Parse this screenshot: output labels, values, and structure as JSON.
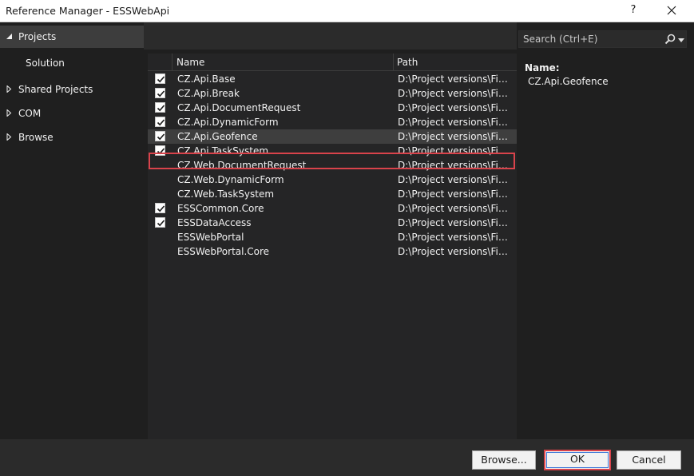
{
  "window": {
    "title": "Reference Manager - ESSWebApi",
    "help_label": "?"
  },
  "nav": {
    "items": [
      {
        "label": "Projects",
        "expanded": true,
        "selected": true
      },
      {
        "label": "Solution",
        "sub": true
      },
      {
        "label": "Shared Projects",
        "expanded": false
      },
      {
        "label": "COM",
        "expanded": false
      },
      {
        "label": "Browse",
        "expanded": false
      }
    ]
  },
  "search": {
    "placeholder": "Search (Ctrl+E)"
  },
  "list": {
    "columns": {
      "name": "Name",
      "path": "Path"
    },
    "rows": [
      {
        "name": "CZ.Api.Base",
        "path": "D:\\Project versions\\Field",
        "checked": true
      },
      {
        "name": "CZ.Api.Break",
        "path": "D:\\Project versions\\Field",
        "checked": true
      },
      {
        "name": "CZ.Api.DocumentRequest",
        "path": "D:\\Project versions\\Field",
        "checked": true
      },
      {
        "name": "CZ.Api.DynamicForm",
        "path": "D:\\Project versions\\Field",
        "checked": true
      },
      {
        "name": "CZ.Api.Geofence",
        "path": "D:\\Project versions\\Field",
        "checked": true,
        "selected": true
      },
      {
        "name": "CZ.Api.TaskSystem",
        "path": "D:\\Project versions\\Field",
        "checked": true
      },
      {
        "name": "CZ.Web.DocumentRequest",
        "path": "D:\\Project versions\\Field",
        "checked": false
      },
      {
        "name": "CZ.Web.DynamicForm",
        "path": "D:\\Project versions\\Field",
        "checked": false
      },
      {
        "name": "CZ.Web.TaskSystem",
        "path": "D:\\Project versions\\Field",
        "checked": false
      },
      {
        "name": "ESSCommon.Core",
        "path": "D:\\Project versions\\Field",
        "checked": true
      },
      {
        "name": "ESSDataAccess",
        "path": "D:\\Project versions\\Field",
        "checked": true
      },
      {
        "name": "ESSWebPortal",
        "path": "D:\\Project versions\\Field",
        "checked": false
      },
      {
        "name": "ESSWebPortal.Core",
        "path": "D:\\Project versions\\Field",
        "checked": false
      }
    ]
  },
  "detail": {
    "name_label": "Name:",
    "name_value": "CZ.Api.Geofence"
  },
  "footer": {
    "browse_label": "Browse...",
    "ok_label": "OK",
    "cancel_label": "Cancel"
  },
  "colors": {
    "background": "#1f1f1f",
    "list_background": "#252526",
    "highlight_border": "#d9434b"
  }
}
